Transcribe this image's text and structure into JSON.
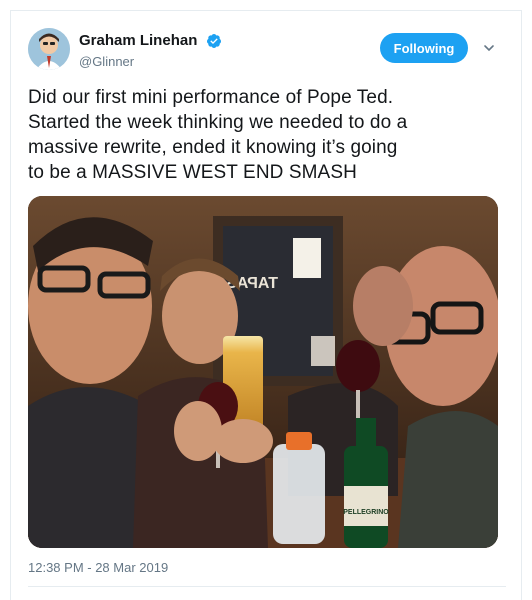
{
  "tweet": {
    "display_name": "Graham Linehan",
    "handle": "@Glinner",
    "verified_icon": "verified-badge-icon",
    "follow_label": "Following",
    "text_lines": [
      "Did our first mini performance of Pope Ted.",
      "Started the week thinking we needed to do a",
      "massive rewrite, ended it knowing it’s going",
      "to be a MASSIVE WEST END SMASH"
    ],
    "timestamp": "12:38 PM - 28 Mar 2019"
  },
  "photo": {
    "sign_text": "TAPAS",
    "bottle_label": "PELLEGRINO"
  },
  "colors": {
    "accent": "#1da1f2",
    "text": "#14171a",
    "secondary": "#657786"
  }
}
